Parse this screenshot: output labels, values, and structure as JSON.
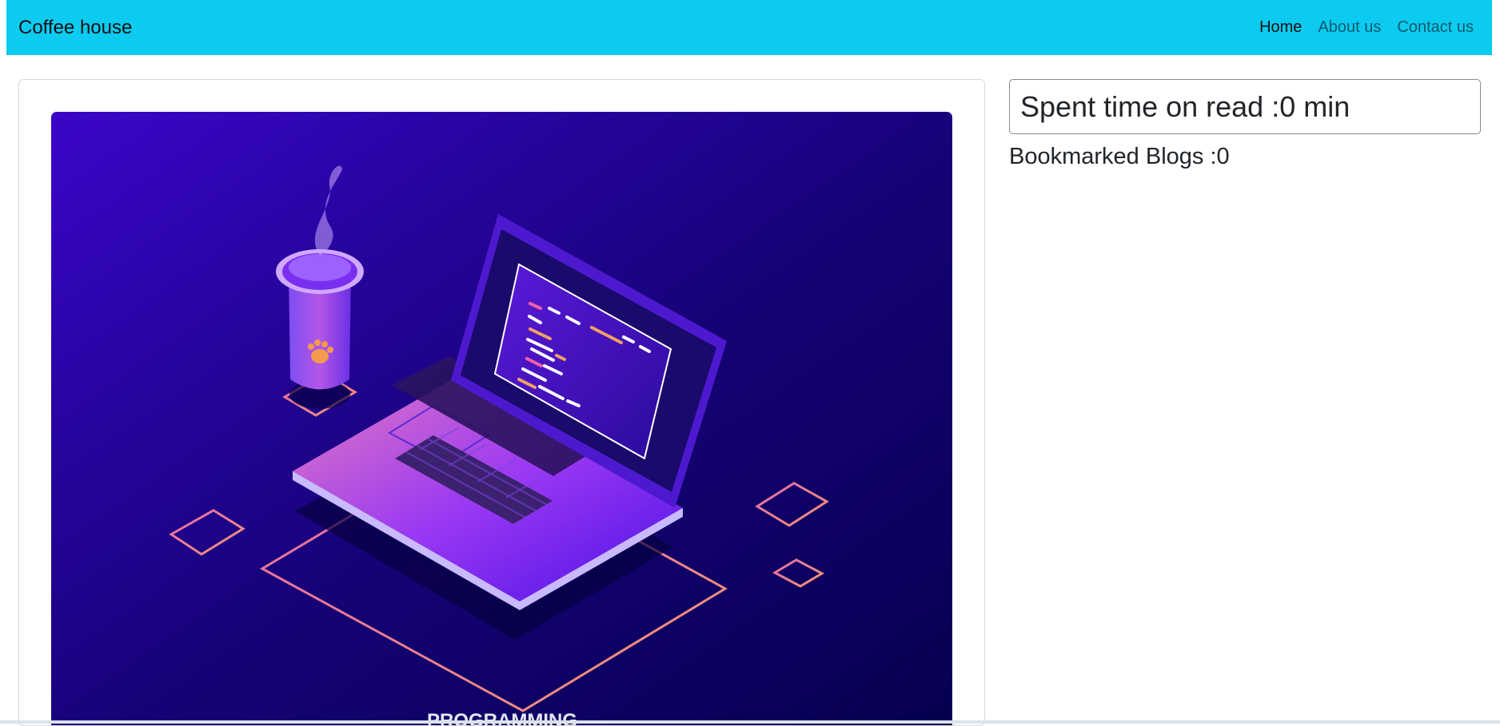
{
  "navbar": {
    "brand": "Coffee house",
    "links": [
      {
        "label": "Home"
      },
      {
        "label": "About us"
      },
      {
        "label": "Contact us"
      }
    ],
    "background_color": "#0dcaf0"
  },
  "blog": {
    "cover_caption": "PROGRAMMING"
  },
  "sidebar": {
    "read_time": "Spent time on read :0 min",
    "bookmarked": "Bookmarked Blogs :0"
  },
  "colors": {
    "accent": "#0dcaf0",
    "cover_gradient_start": "#3a06c9",
    "cover_gradient_end": "#06004f",
    "outline_orange": "#f08a74"
  }
}
